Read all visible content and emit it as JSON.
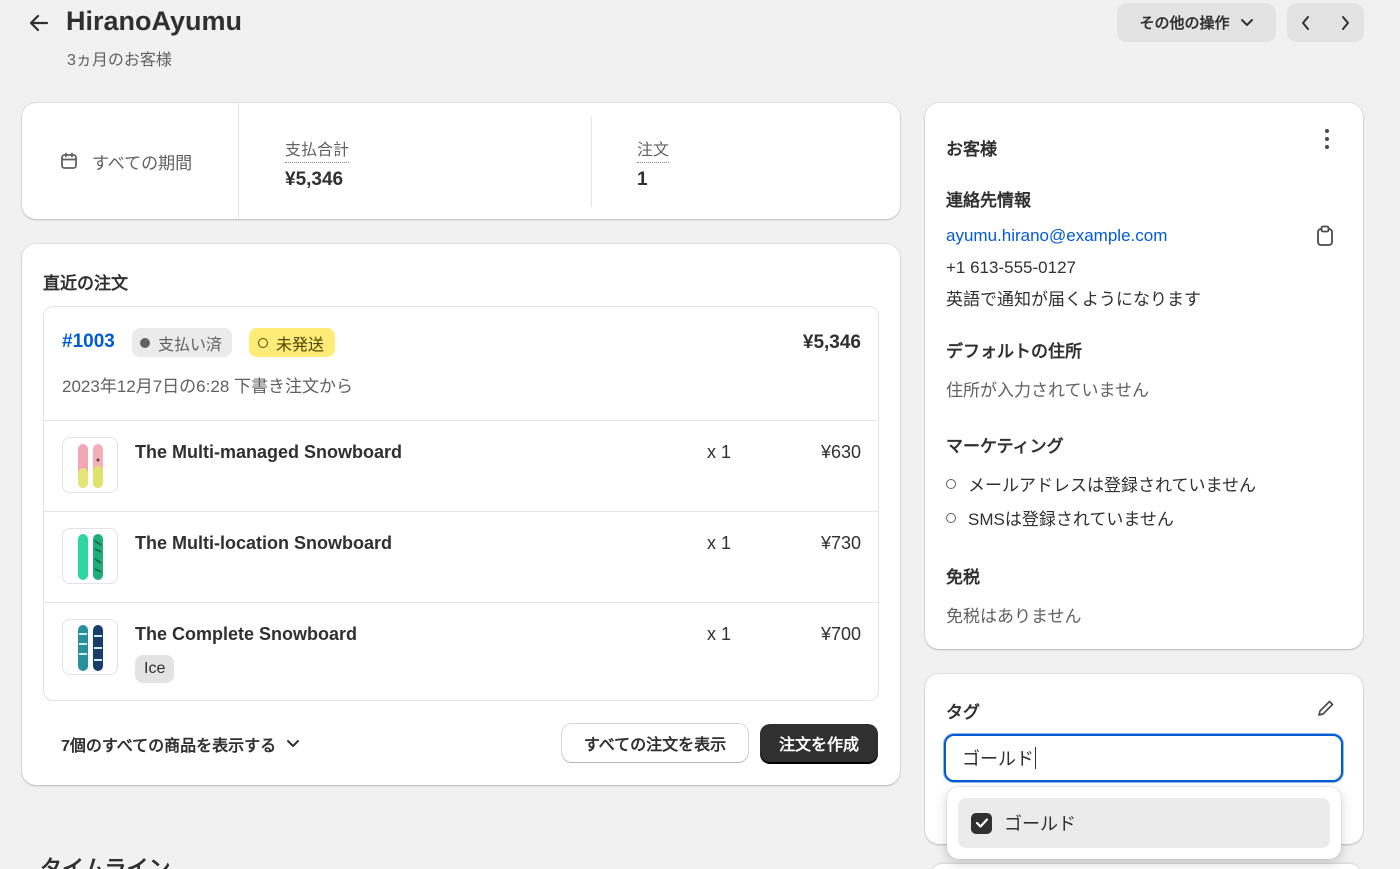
{
  "header": {
    "back_icon": "arrow-left-icon",
    "title": "HiranoAyumu",
    "subtitle": "3ヵ月のお客様",
    "more_actions_label": "その他の操作",
    "prev_icon": "chevron-left-icon",
    "next_icon": "chevron-right-icon"
  },
  "stats": {
    "period_label": "すべての期間",
    "total_spent_label": "支払合計",
    "total_spent_value": "¥5,346",
    "orders_label": "注文",
    "orders_value": "1"
  },
  "recent_orders": {
    "heading": "直近の注文",
    "order_number": "#1003",
    "payment_badge": "支払い済",
    "fulfillment_badge": "未発送",
    "total": "¥5,346",
    "date_text": "2023年12月7日の6:28 下書き注文から",
    "items": [
      {
        "name": "The Multi-managed Snowboard",
        "qty": "x 1",
        "price": "¥630",
        "variant": ""
      },
      {
        "name": "The Multi-location Snowboard",
        "qty": "x 1",
        "price": "¥730",
        "variant": ""
      },
      {
        "name": "The Complete Snowboard",
        "qty": "x 1",
        "price": "¥700",
        "variant": "Ice"
      }
    ],
    "show_all_items_label": "7個のすべての商品を表示する",
    "view_all_orders_label": "すべての注文を表示",
    "create_order_label": "注文を作成"
  },
  "timeline": {
    "heading": "タイムライン"
  },
  "customer": {
    "heading": "お客様",
    "contact_heading": "連絡先情報",
    "email": "ayumu.hirano@example.com",
    "phone": "+1 613-555-0127",
    "language_note": "英語で通知が届くようになります",
    "address_heading": "デフォルトの住所",
    "address_value": "住所が入力されていません",
    "marketing_heading": "マーケティング",
    "marketing_email": "メールアドレスは登録されていません",
    "marketing_sms": "SMSは登録されていません",
    "tax_heading": "免税",
    "tax_value": "免税はありません"
  },
  "tags": {
    "heading": "タグ",
    "input_value": "ゴールド",
    "option_label": "ゴールド",
    "option_checked": true
  },
  "colors": {
    "link": "#005bd3",
    "unfulfilled_badge": "#ffeb78",
    "primary_button": "#303030",
    "background": "#f1f1f1"
  }
}
